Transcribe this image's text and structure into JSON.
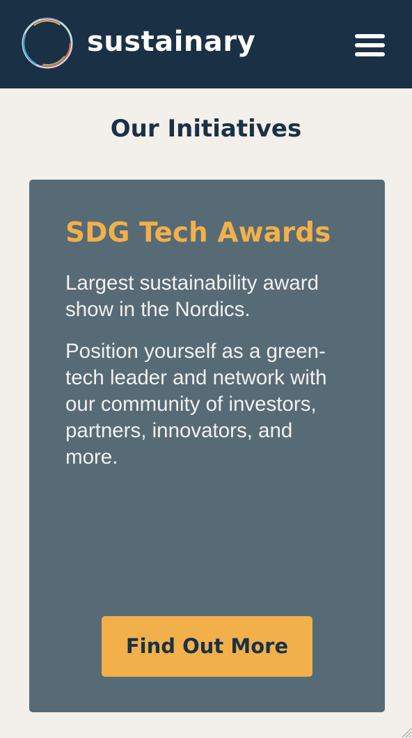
{
  "header": {
    "brand": "sustainary",
    "logo_icon": "circle-logo-icon",
    "menu_icon": "hamburger-menu-icon",
    "background_color": "#1a3145"
  },
  "main": {
    "section_title": "Our Initiatives",
    "card": {
      "title": "SDG Tech Awards",
      "paragraphs": [
        "Largest sustainability award show in the Nordics.",
        "Position yourself as a green-tech leader and  network with our community of investors, partners, innovators, and more."
      ],
      "button_label": "Find Out More",
      "background_color": "#576b77",
      "accent_color": "#f2b04a"
    }
  },
  "page_background_color": "#f3efeb"
}
